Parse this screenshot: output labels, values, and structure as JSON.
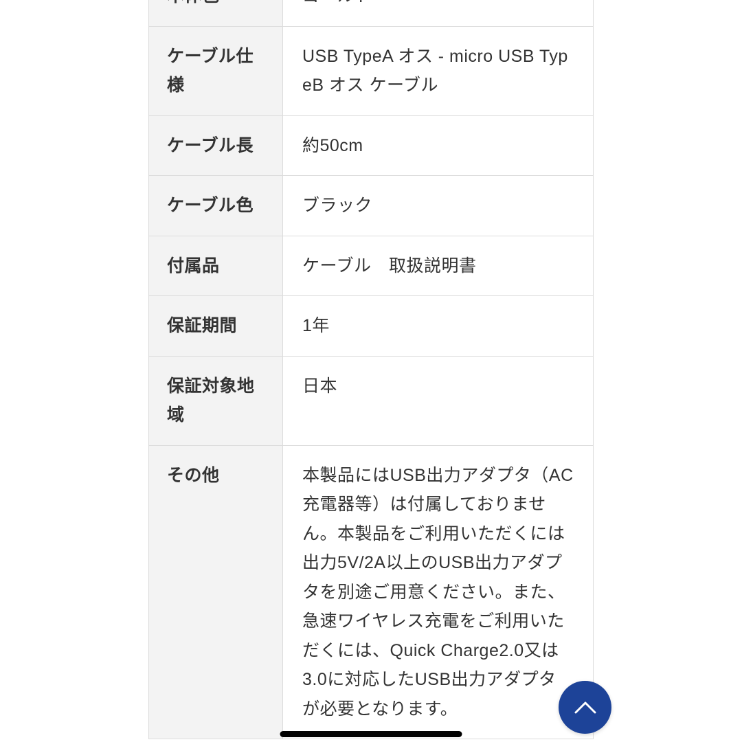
{
  "spec_rows": [
    {
      "label": "本体色",
      "value": "ゴールド"
    },
    {
      "label": "ケーブル仕様",
      "value": "USB TypeA オス - micro USB TypeB オス ケーブル"
    },
    {
      "label": "ケーブル長",
      "value": "約50cm"
    },
    {
      "label": "ケーブル色",
      "value": "ブラック"
    },
    {
      "label": "付属品",
      "value": "ケーブル　取扱説明書"
    },
    {
      "label": "保証期間",
      "value": "1年"
    },
    {
      "label": "保証対象地域",
      "value": "日本"
    },
    {
      "label": "その他",
      "value": "本製品にはUSB出力アダプタ（AC充電器等）は付属しておりません。本製品をご利用いただくには出力5V/2A以上のUSB出力アダプタを別途ご用意ください。また、急速ワイヤレス充電をご利用いただくには、Quick Charge2.0又は3.0に対応したUSB出力アダプタが必要となります。"
    }
  ]
}
